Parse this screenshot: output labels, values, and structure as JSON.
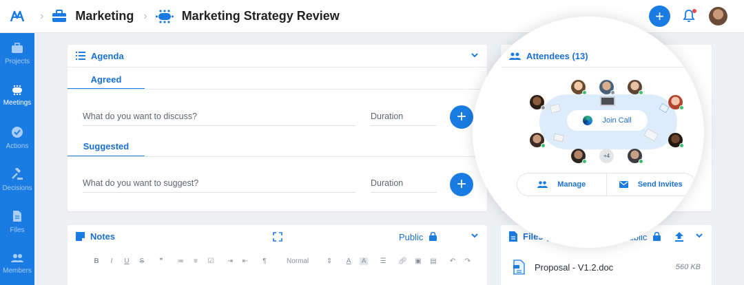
{
  "header": {
    "breadcrumb": [
      {
        "label": "Marketing",
        "icon": "briefcase-icon"
      },
      {
        "label": "Marketing Strategy Review",
        "icon": "meeting-table-icon"
      }
    ],
    "add_button_label": "+",
    "accent_color": "#1a7ce3"
  },
  "sidebar": {
    "items": [
      {
        "label": "Projects",
        "icon": "briefcase-icon",
        "active": false
      },
      {
        "label": "Meetings",
        "icon": "meeting-table-icon",
        "active": true
      },
      {
        "label": "Actions",
        "icon": "check-circle-icon",
        "active": false
      },
      {
        "label": "Decisions",
        "icon": "gavel-icon",
        "active": false
      },
      {
        "label": "Files",
        "icon": "file-icon",
        "active": false
      },
      {
        "label": "Members",
        "icon": "people-icon",
        "active": false
      }
    ]
  },
  "agenda": {
    "title": "Agenda",
    "sections": [
      {
        "tab": "Agreed",
        "input_placeholder": "What do you want to discuss?",
        "duration_placeholder": "Duration"
      },
      {
        "tab": "Suggested",
        "input_placeholder": "What do you want to suggest?",
        "duration_placeholder": "Duration"
      }
    ]
  },
  "attendees": {
    "title": "Attendees (13)",
    "join_label": "Join Call",
    "more_count": "+4",
    "manage_label": "Manage",
    "invite_label": "Send Invites"
  },
  "notes": {
    "title": "Notes",
    "visibility": "Public",
    "toolbar": {
      "format_select": "Normal"
    }
  },
  "files": {
    "title": "Files (4)",
    "visibility": "Public",
    "items": [
      {
        "name": "Proposal - V1.2.doc",
        "size": "560 KB"
      }
    ]
  }
}
